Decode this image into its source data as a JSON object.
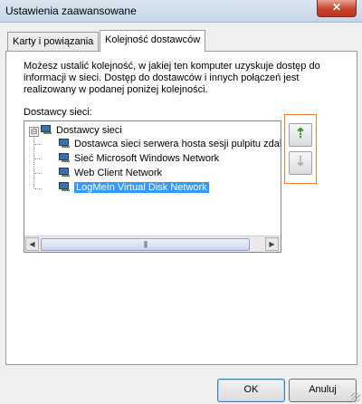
{
  "window": {
    "title": "Ustawienia zaawansowane",
    "close_icon": "close-icon",
    "close_glyph": "✕"
  },
  "tabs": [
    {
      "label": "Karty i powiązania",
      "active": false
    },
    {
      "label": "Kolejność dostawców",
      "active": true
    }
  ],
  "content": {
    "description_lines": [
      "Możesz ustalić kolejność, w jakiej ten komputer uzyskuje dostęp do",
      "informacji w sieci. Dostęp do dostawców i innych połączeń jest",
      "realizowany w podanej poniżej kolejności."
    ],
    "list_label": "Dostawcy sieci:",
    "tree": {
      "root": {
        "label": "Dostawcy sieci",
        "expander": "⊟"
      },
      "items": [
        {
          "label": "Dostawca sieci serwera hosta sesji pulpitu zdaln"
        },
        {
          "label": "Sieć Microsoft Windows Network"
        },
        {
          "label": "Web Client Network"
        },
        {
          "label": "LogMeIn Virtual Disk Network",
          "selected": true
        }
      ]
    },
    "scrollbar": {
      "left_arrow": "◀",
      "right_arrow": "▶",
      "thumb_grip": "|||"
    },
    "move_up": {
      "glyph": "⇡",
      "icon": "arrow-up-icon"
    },
    "move_down": {
      "glyph": "⇣",
      "icon": "arrow-down-icon"
    }
  },
  "footer": {
    "ok_label": "OK",
    "cancel_label": "Anuluj"
  }
}
